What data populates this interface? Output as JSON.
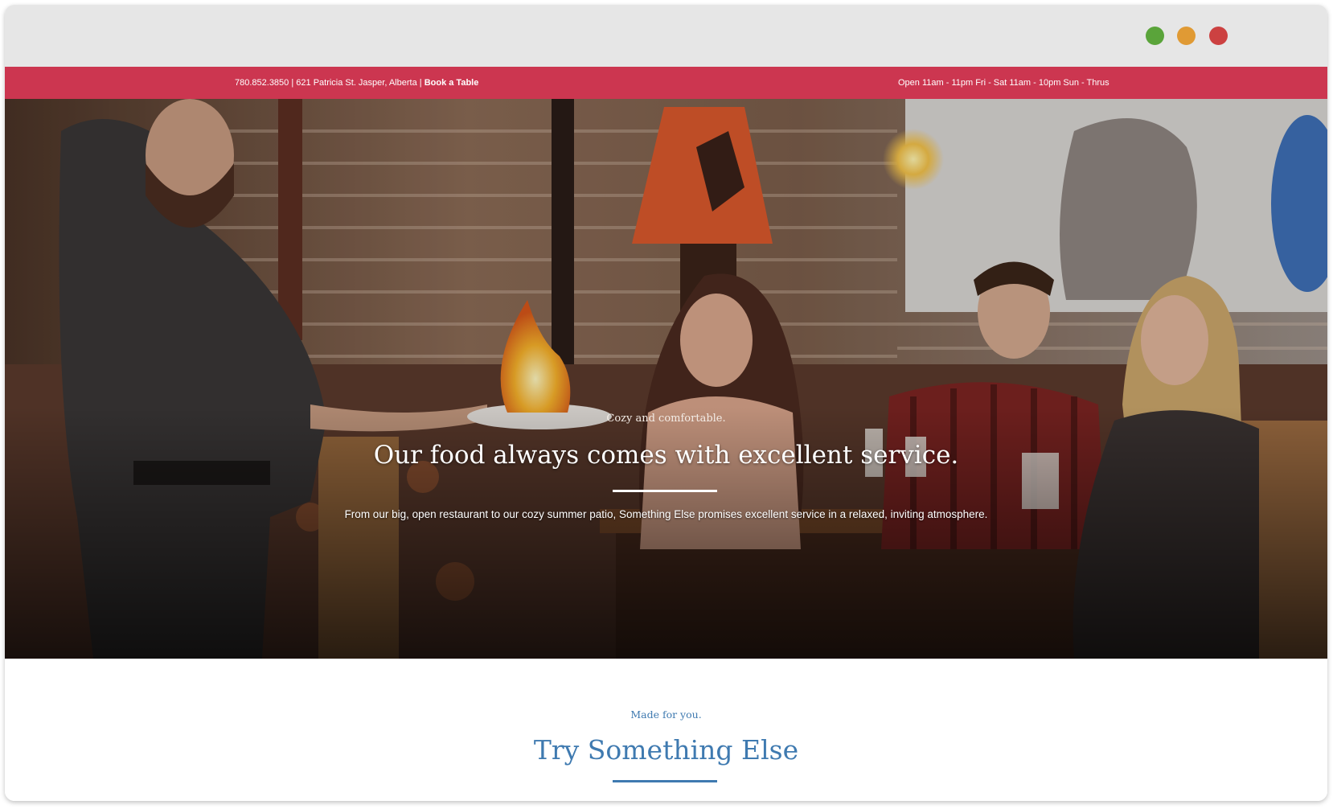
{
  "window": {
    "controls": [
      "green",
      "orange",
      "red"
    ]
  },
  "topbar": {
    "phone": "780.852.3850",
    "separator1": " | ",
    "address": "621 Patricia St. Jasper, Alberta",
    "separator2": " | ",
    "book_label": "Book a Table",
    "hours": "Open 11am - 11pm Fri - Sat 11am - 10pm Sun - Thrus",
    "color": "#cc3650"
  },
  "hero": {
    "eyebrow": "Cozy and comfortable.",
    "headline": "Our food always comes with excellent service.",
    "description": "From our big, open restaurant to our cozy summer patio, Something Else promises excellent service in a relaxed, inviting atmosphere."
  },
  "section": {
    "eyebrow": "Made for you.",
    "title": "Try Something Else",
    "accent": "#3f7ab0"
  }
}
